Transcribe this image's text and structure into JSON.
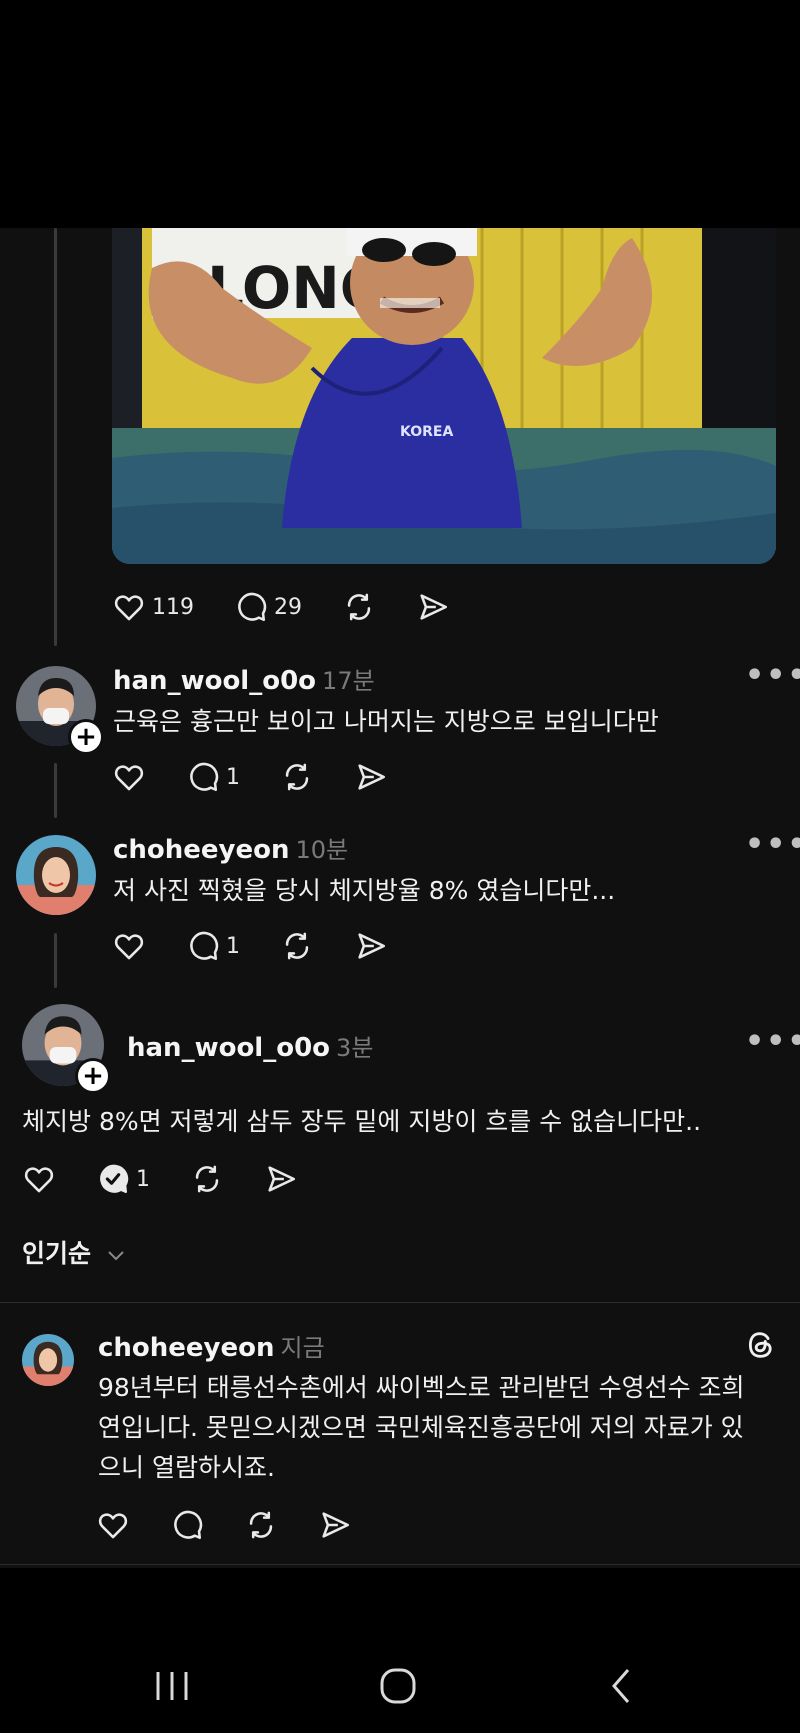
{
  "post": {
    "photo_alt_text": "LONGI",
    "photo_suit_text": "KOREA",
    "stats": {
      "likes": "119",
      "comments": "29"
    }
  },
  "replies": [
    {
      "username": "han_wool_o0o",
      "time": "17분",
      "text": "근육은 흉근만 보이고 나머지는 지방으로 보입니다만",
      "comment_count": "1"
    },
    {
      "username": "choheeyeon",
      "time": "10분",
      "text": "저 사진 찍혔을 당시 체지방율 8% 였습니다만...",
      "comment_count": "1"
    },
    {
      "username": "han_wool_o0o",
      "time": "3분",
      "text": "체지방 8%면 저렇게 삼두 장두 밑에 지방이 흐를 수 없습니다만..",
      "comment_count": "1"
    }
  ],
  "sort_label": "인기순",
  "latest_reply": {
    "username": "choheeyeon",
    "time": "지금",
    "lines": [
      "98년부터 태릉선수촌에서 싸이벡스로 관리받던 수영선수 조희",
      "연입니다. 못믿으시겠으면 국민체육진흥공단에 저의 자료가 있",
      "으니 열람하시죠."
    ]
  },
  "more_glyph": "•••",
  "plus_glyph": "+"
}
